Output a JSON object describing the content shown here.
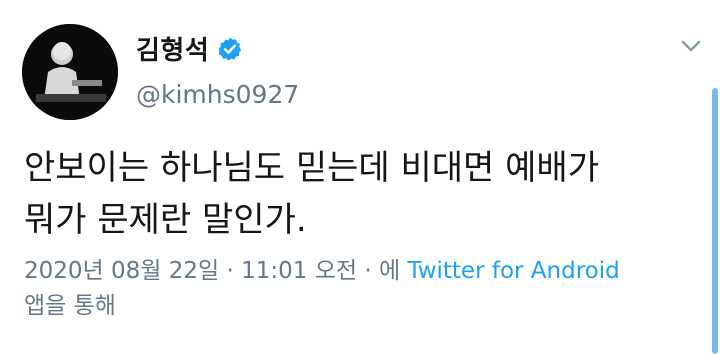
{
  "user": {
    "display_name": "김형석",
    "handle": "@kimhs0927",
    "verified": true
  },
  "tweet": {
    "text_lines": [
      "안보이는 하나님도 믿는데 비대면 예배가",
      "뭐가 문제란 말인가."
    ],
    "date": "2020년 08월 22일",
    "time": "11:01 오전",
    "separator": "·",
    "via_prefix": "에",
    "source": "Twitter for Android",
    "via_suffix": "앱을 통해"
  },
  "icons": {
    "verified": "verified-badge-icon",
    "menu": "chevron-down-icon"
  },
  "colors": {
    "accent": "#1da1f2",
    "muted": "#657786",
    "text": "#14171a",
    "scrollbar": "#7fb8e6"
  }
}
